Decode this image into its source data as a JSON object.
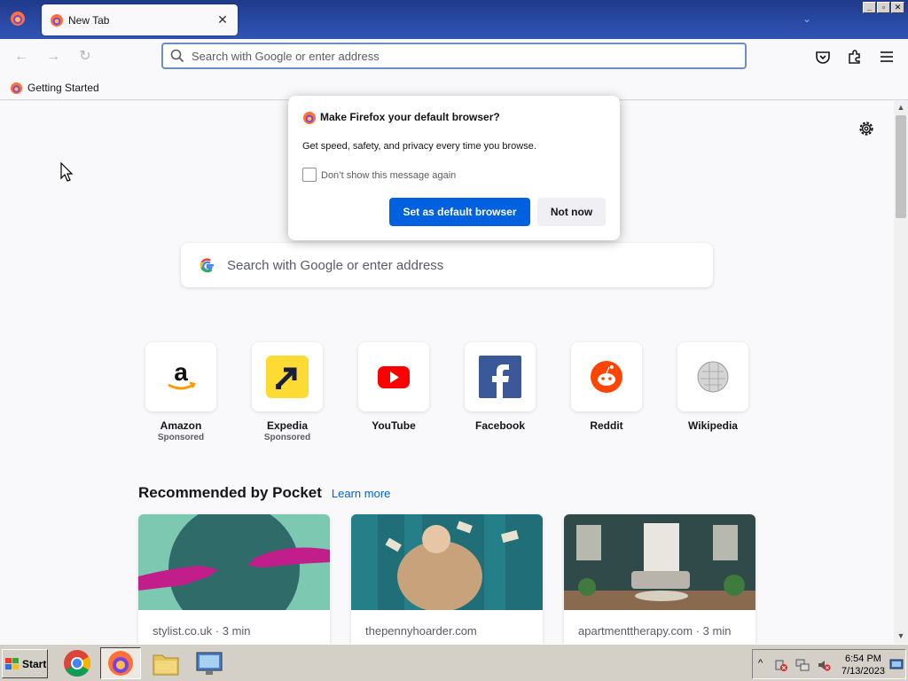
{
  "browser": {
    "tab": {
      "title": "New Tab",
      "close": "✕"
    },
    "tab_list": "⌄",
    "window_controls": [
      "_",
      "▫",
      "✕"
    ],
    "nav": {
      "back": "←",
      "forward": "→",
      "reload": "↻"
    },
    "urlbar": {
      "placeholder": "Search with Google or enter address",
      "value": ""
    },
    "toolbar_icons": [
      "pocket-icon",
      "extensions-icon",
      "menu-icon"
    ],
    "bookmarks": [
      {
        "label": "Getting Started"
      }
    ]
  },
  "newtab": {
    "search_placeholder": "Search with Google or enter address",
    "top_sites": [
      {
        "label": "Amazon",
        "sponsor": "Sponsored",
        "icon": "amazon-icon"
      },
      {
        "label": "Expedia",
        "sponsor": "Sponsored",
        "icon": "expedia-icon"
      },
      {
        "label": "YouTube",
        "sponsor": "",
        "icon": "youtube-icon"
      },
      {
        "label": "Facebook",
        "sponsor": "",
        "icon": "facebook-icon"
      },
      {
        "label": "Reddit",
        "sponsor": "",
        "icon": "reddit-icon"
      },
      {
        "label": "Wikipedia",
        "sponsor": "",
        "icon": "wikipedia-icon"
      }
    ],
    "pocket": {
      "title": "Recommended by Pocket",
      "learn_more": "Learn more",
      "cards": [
        {
          "source": "stylist.co.uk · 3 min"
        },
        {
          "source": "thepennyhoarder.com"
        },
        {
          "source": "apartmenttherapy.com · 3 min"
        }
      ]
    }
  },
  "dialog": {
    "title": "Make Firefox your default browser?",
    "description": "Get speed, safety, and privacy every time you browse.",
    "checkbox_label": "Don’t show this message again",
    "checkbox_checked": false,
    "primary_button": "Set as default browser",
    "secondary_button": "Not now"
  },
  "taskbar": {
    "start_label": "Start",
    "apps": [
      "chrome-icon",
      "firefox-icon",
      "file-explorer-icon",
      "control-panel-icon"
    ],
    "tray_expand": "^",
    "clock_time": "6:54 PM",
    "clock_date": "7/13/2023"
  },
  "colors": {
    "accent": "#0061e0",
    "titlebar": "#2a4aa6",
    "page_bg": "#f9f9fb"
  }
}
